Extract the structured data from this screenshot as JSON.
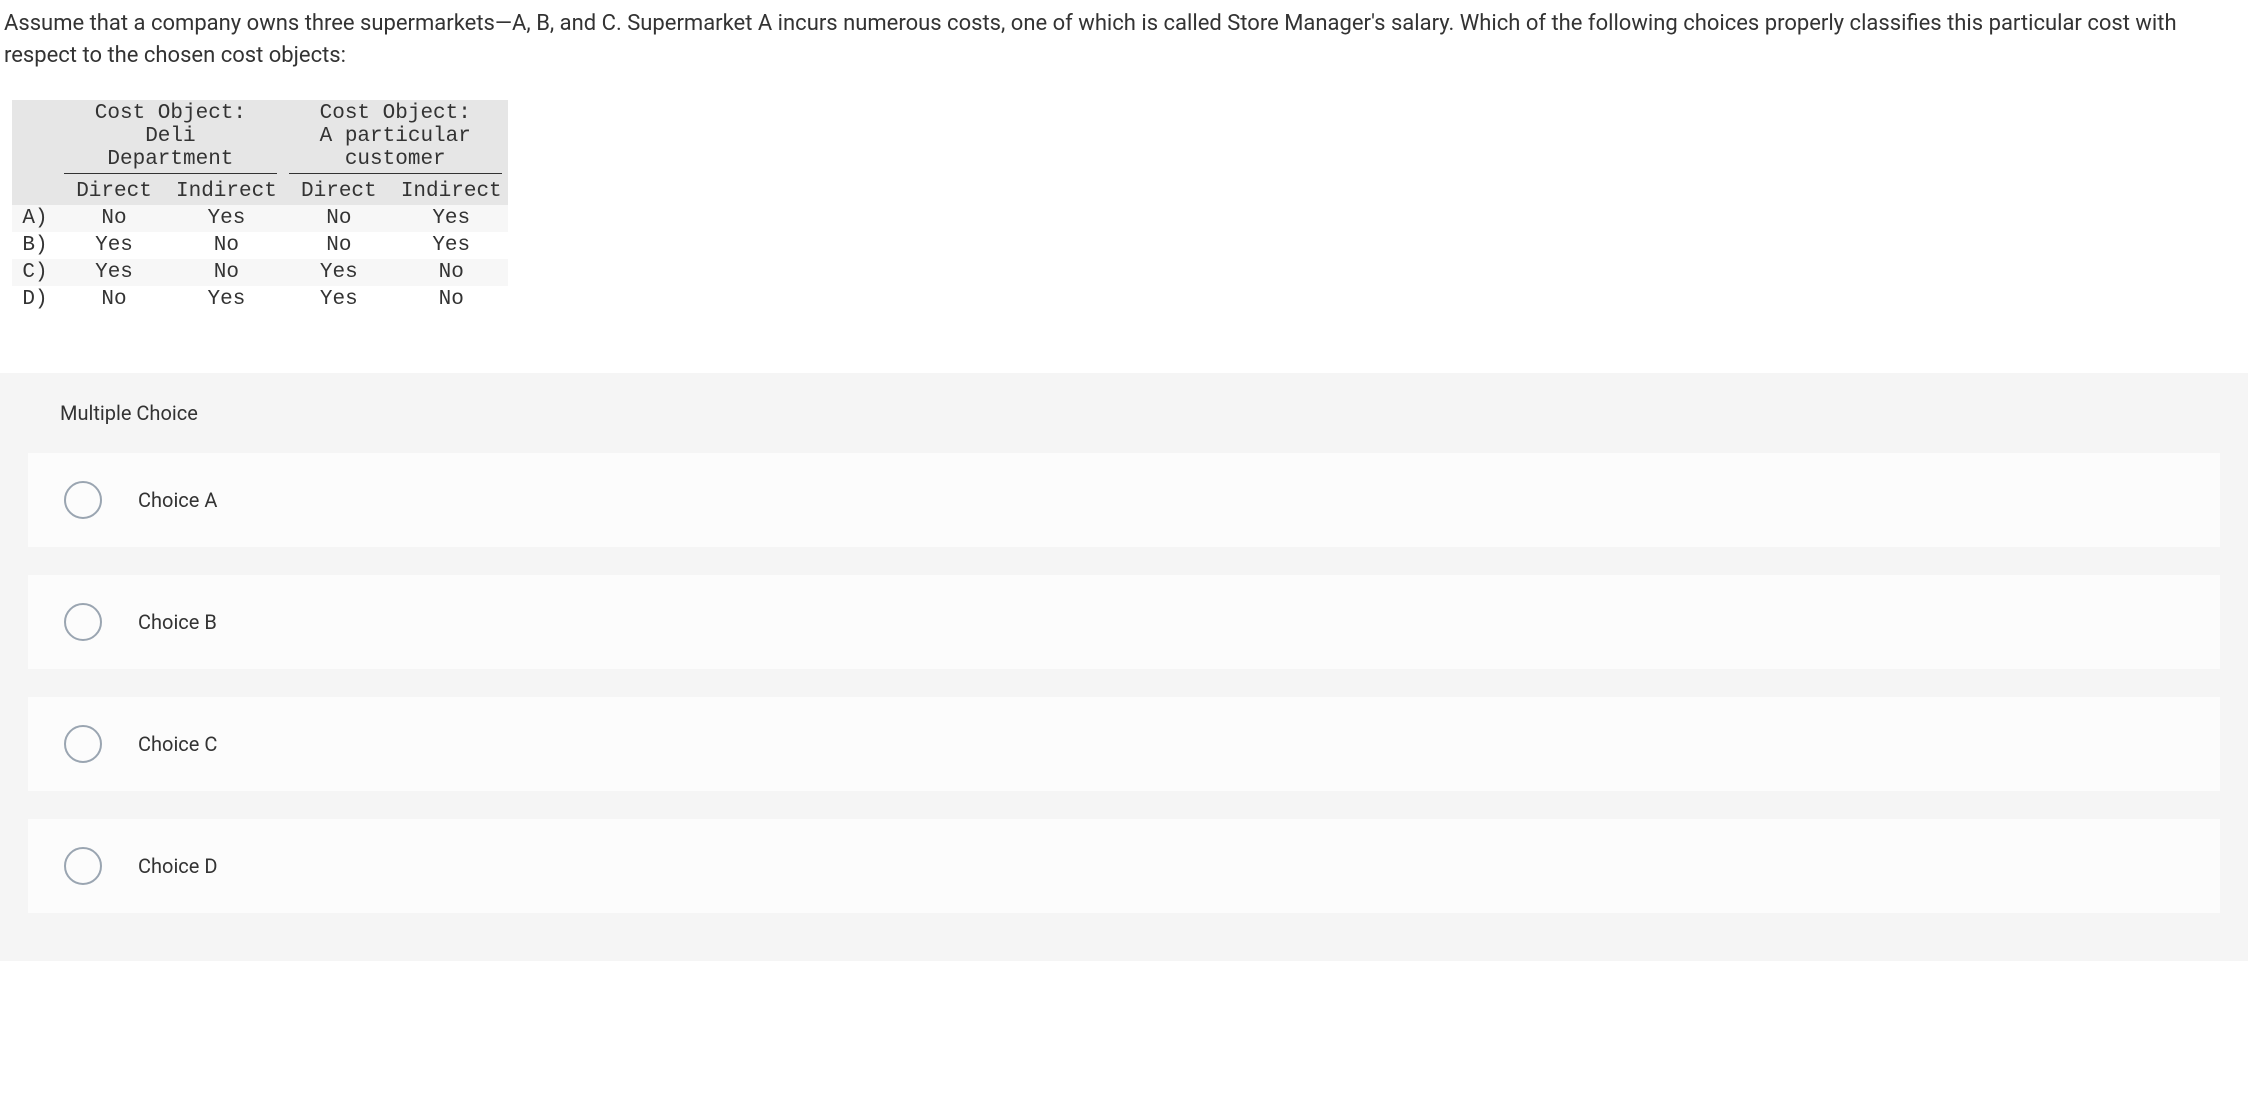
{
  "question": "Assume that a company owns three supermarkets—A, B, and C. Supermarket A incurs numerous costs, one of which is called Store Manager's salary. Which of the following choices properly classifies this particular cost with respect to the chosen cost objects:",
  "table": {
    "groupHeaders": [
      "Cost Object: Deli Department",
      "Cost Object: A particular customer"
    ],
    "subHeaders": [
      "Direct",
      "Indirect",
      "Direct",
      "Indirect"
    ],
    "rows": [
      {
        "label": "A)",
        "cells": [
          "No",
          "Yes",
          "No",
          "Yes"
        ]
      },
      {
        "label": "B)",
        "cells": [
          "Yes",
          "No",
          "No",
          "Yes"
        ]
      },
      {
        "label": "C)",
        "cells": [
          "Yes",
          "No",
          "Yes",
          "No"
        ]
      },
      {
        "label": "D)",
        "cells": [
          "No",
          "Yes",
          "Yes",
          "No"
        ]
      }
    ]
  },
  "mcHeader": "Multiple Choice",
  "choices": [
    {
      "label": "Choice A"
    },
    {
      "label": "Choice B"
    },
    {
      "label": "Choice C"
    },
    {
      "label": "Choice D"
    }
  ]
}
